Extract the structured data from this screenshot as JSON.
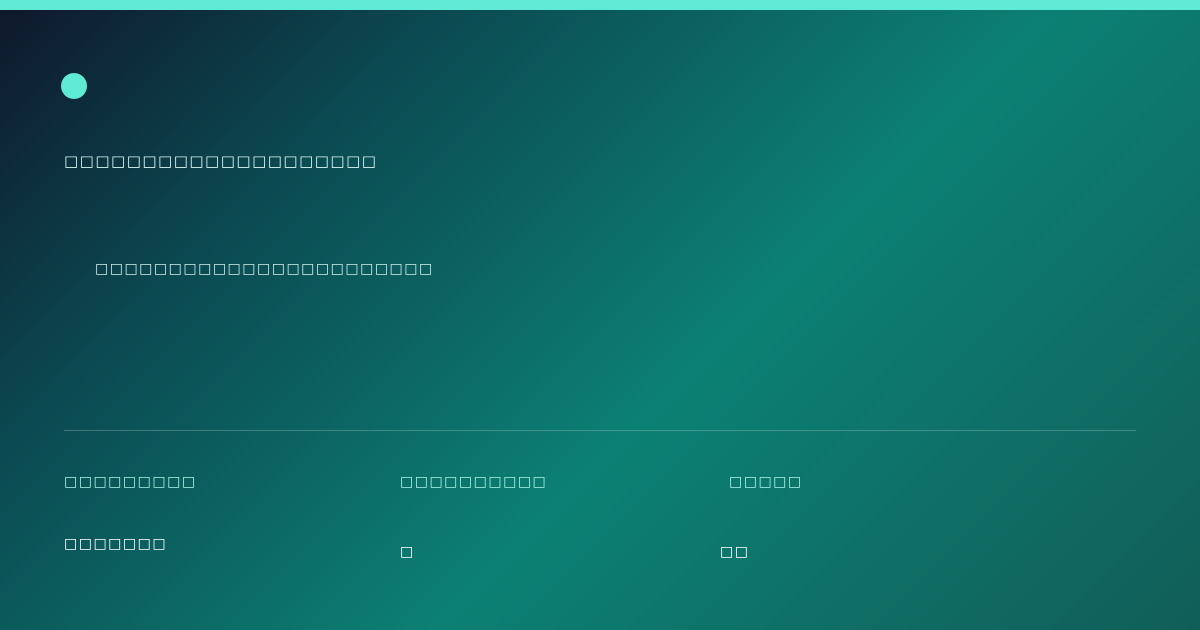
{
  "header": {
    "headline": "□□□□□□□□□□□□□□□□□□□□",
    "subheadline": "□□□□□□□□□□□□□□□□□□□□□□□"
  },
  "stats": [
    {
      "label": "□□□□□□□□□",
      "value": "□□□□□□□"
    },
    {
      "label": "□□□□□□□□□□",
      "value": "□"
    },
    {
      "label": "□□□□□",
      "value": "□□"
    }
  ],
  "colors": {
    "accent": "#5eead4",
    "background_dark": "#0f172a",
    "background_teal": "#0c8074"
  }
}
